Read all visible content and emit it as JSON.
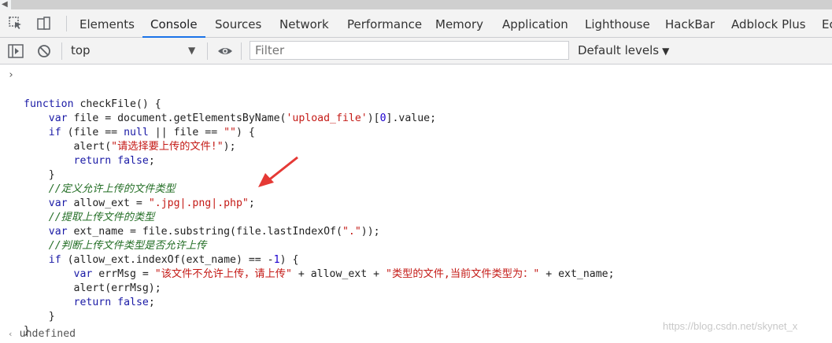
{
  "toolbar": {
    "tabs": [
      "Elements",
      "Console",
      "Sources",
      "Network",
      "Performance",
      "Memory",
      "Application",
      "Lighthouse",
      "HackBar",
      "Adblock Plus",
      "Ec"
    ],
    "active_tab": "Console"
  },
  "console_toolbar": {
    "context": "top",
    "filter_placeholder": "Filter",
    "levels": "Default levels"
  },
  "console": {
    "prompt": "›",
    "code_lines": [
      "",
      "function checkFile() {",
      "    var file = document.getElementsByName('upload_file')[0].value;",
      "    if (file == null || file == \"\") {",
      "        alert(\"请选择要上传的文件!\");",
      "        return false;",
      "    }",
      "    //定义允许上传的文件类型",
      "    var allow_ext = \".jpg|.png|.php\";",
      "    //提取上传文件的类型",
      "    var ext_name = file.substring(file.lastIndexOf(\".\"));",
      "    //判断上传文件类型是否允许上传",
      "    if (allow_ext.indexOf(ext_name) == -1) {",
      "        var errMsg = \"该文件不允许上传，请上传\" + allow_ext + \"类型的文件,当前文件类型为：\" + ext_name;",
      "        alert(errMsg);",
      "        return false;",
      "    }",
      "}"
    ],
    "result": "undefined",
    "result_marker": "‹"
  },
  "watermark": "https://blog.csdn.net/skynet_x",
  "colors": {
    "keyword": "#1a1aa6",
    "string": "#c41a16",
    "comment": "#236e25",
    "active_tab_underline": "#1a73e8",
    "annotation_arrow": "#e53935"
  }
}
